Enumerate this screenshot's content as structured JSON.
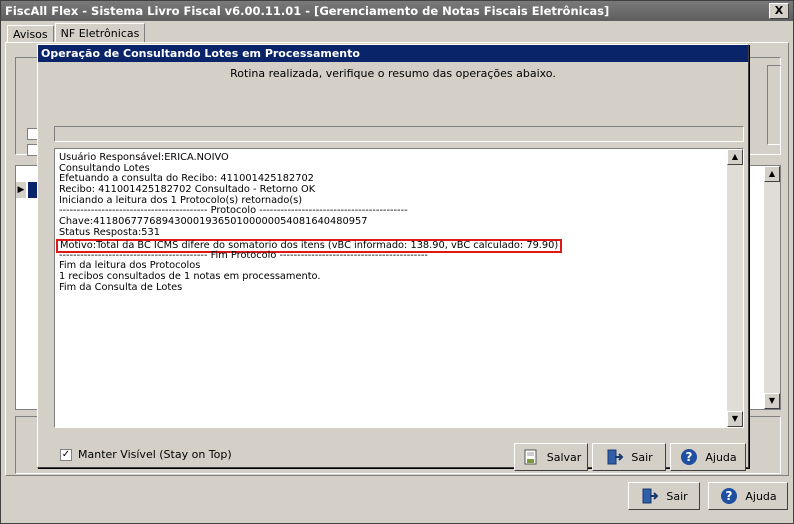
{
  "main_window": {
    "title": "FiscAll Flex - Sistema Livro Fiscal v6.00.11.01 - [Gerenciamento de Notas Fiscais Eletrônicas]",
    "close_label": "X"
  },
  "tabs": [
    {
      "label": "Avisos"
    },
    {
      "label": "NF Eletrônicas"
    }
  ],
  "footer": {
    "exit_label": "Sair",
    "help_label": "Ajuda"
  },
  "dialog": {
    "title": "Operação de Consultando Lotes em Processamento",
    "status_message": "Rotina realizada, verifique o resumo das operações abaixo.",
    "log_lines": [
      "Usuário Responsável:ERICA.NOIVO",
      "Consultando Lotes",
      "Efetuando a consulta do Recibo: 411001425182702",
      "Recibo: 411001425182702 Consultado - Retorno OK",
      "Iniciando a leitura dos 1 Protocolo(s) retornado(s)",
      "------------------------------------------ Protocolo ------------------------------------------",
      "Chave:41180677768943000193650100000054081640480957",
      "Status Resposta:531",
      "Motivo:Total da BC ICMS difere do somatorio dos itens (vBC informado: 138.90, vBC calculado: 79.90)",
      "------------------------------------------ Fim Protocolo ------------------------------------------",
      "Fim da leitura dos Protocolos",
      "1 recibos consultados de 1 notas em processamento.",
      "Fim da Consulta de Lotes"
    ],
    "stay_on_top_label": "Manter Visível (Stay on Top)",
    "stay_on_top_checked": true,
    "save_label": "Salvar",
    "exit_label": "Sair",
    "help_label": "Ajuda"
  },
  "colors": {
    "titlebar_active": "#0a246a",
    "highlight_border": "#e01818",
    "window_face": "#d4d0c8"
  }
}
